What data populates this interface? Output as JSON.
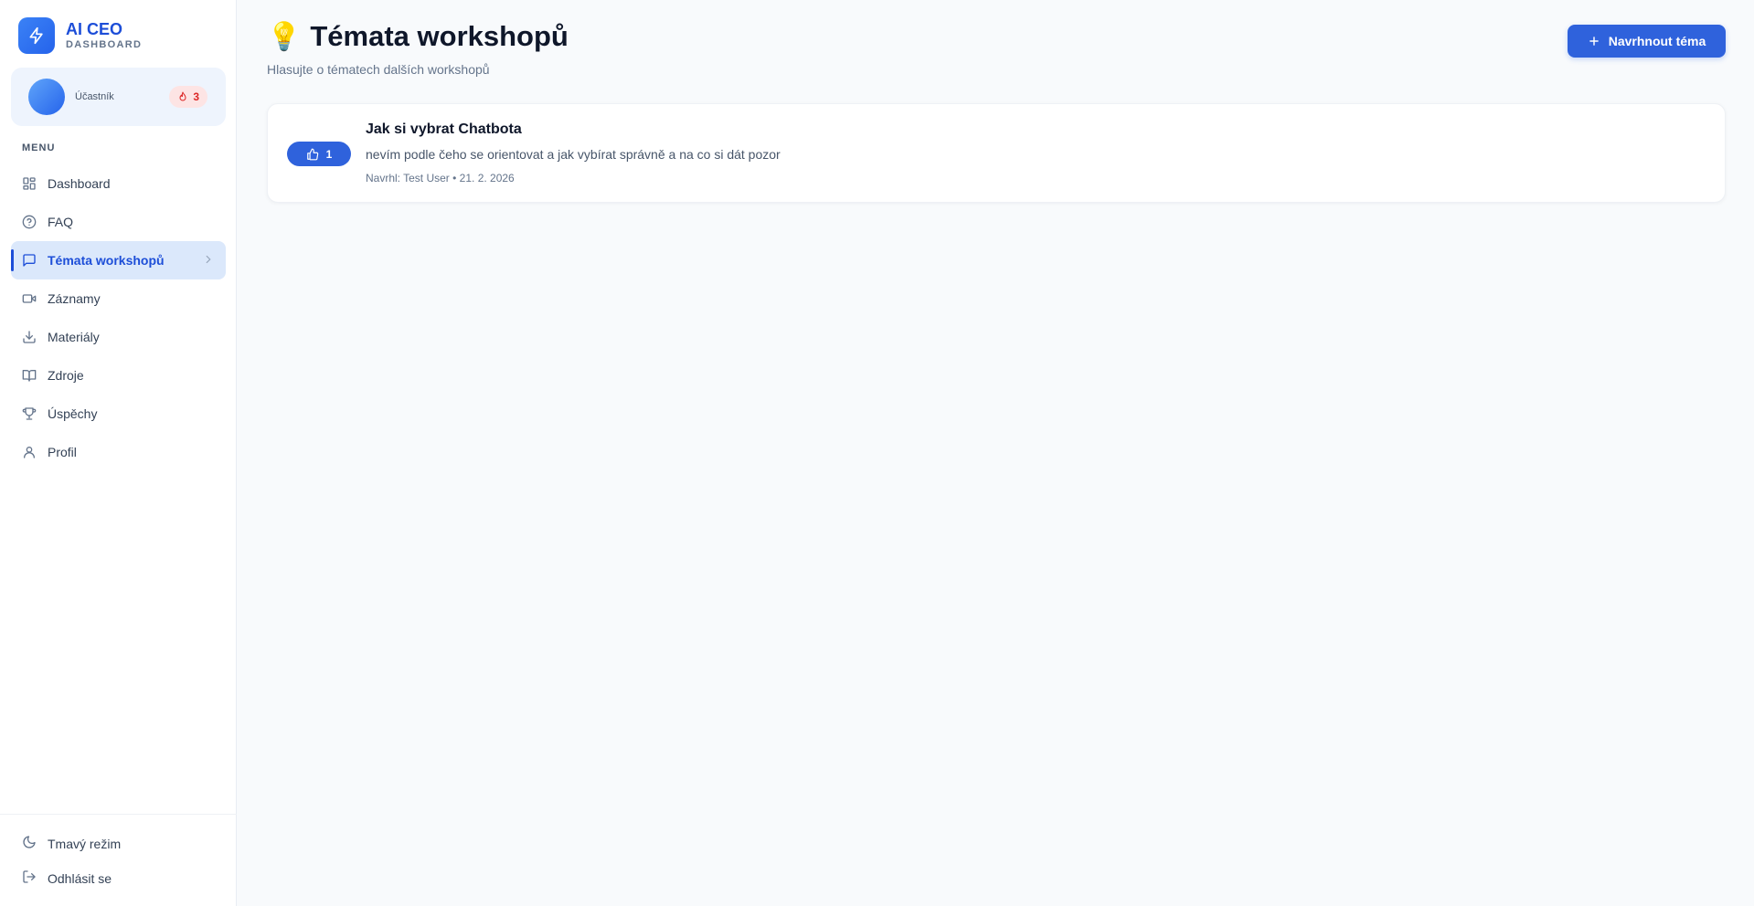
{
  "brand": {
    "title": "AI CEO",
    "subtitle": "DASHBOARD",
    "icon": "bolt-icon"
  },
  "user": {
    "role": "Účastník",
    "streak": "3",
    "streak_icon": "flame-icon"
  },
  "menu": {
    "label": "MENU",
    "items": [
      {
        "label": "Dashboard",
        "icon": "grid-icon"
      },
      {
        "label": "FAQ",
        "icon": "help-circle-icon"
      },
      {
        "label": "Témata workshopů",
        "icon": "message-square-icon",
        "active": true
      },
      {
        "label": "Záznamy",
        "icon": "video-icon"
      },
      {
        "label": "Materiály",
        "icon": "download-icon"
      },
      {
        "label": "Zdroje",
        "icon": "book-open-icon"
      },
      {
        "label": "Úspěchy",
        "icon": "trophy-icon"
      },
      {
        "label": "Profil",
        "icon": "user-icon"
      }
    ]
  },
  "bottom": {
    "dark_mode": "Tmavý režim",
    "logout": "Odhlásit se"
  },
  "page": {
    "emoji": "💡",
    "title": "Témata workshopů",
    "subtitle": "Hlasujte o tématech dalších workshopů",
    "suggest_button": "Navrhnout téma"
  },
  "topics": [
    {
      "votes": "1",
      "title": "Jak si vybrat Chatbota",
      "description": "nevím podle čeho se orientovat a jak vybírat správně a na co si dát pozor",
      "meta": "Navrhl: Test User • 21. 2. 2026"
    }
  ],
  "colors": {
    "accent": "#2f62dc",
    "active_bg": "#dbe8fb",
    "streak_bg": "#fde4e4",
    "streak_fg": "#dc2626"
  }
}
